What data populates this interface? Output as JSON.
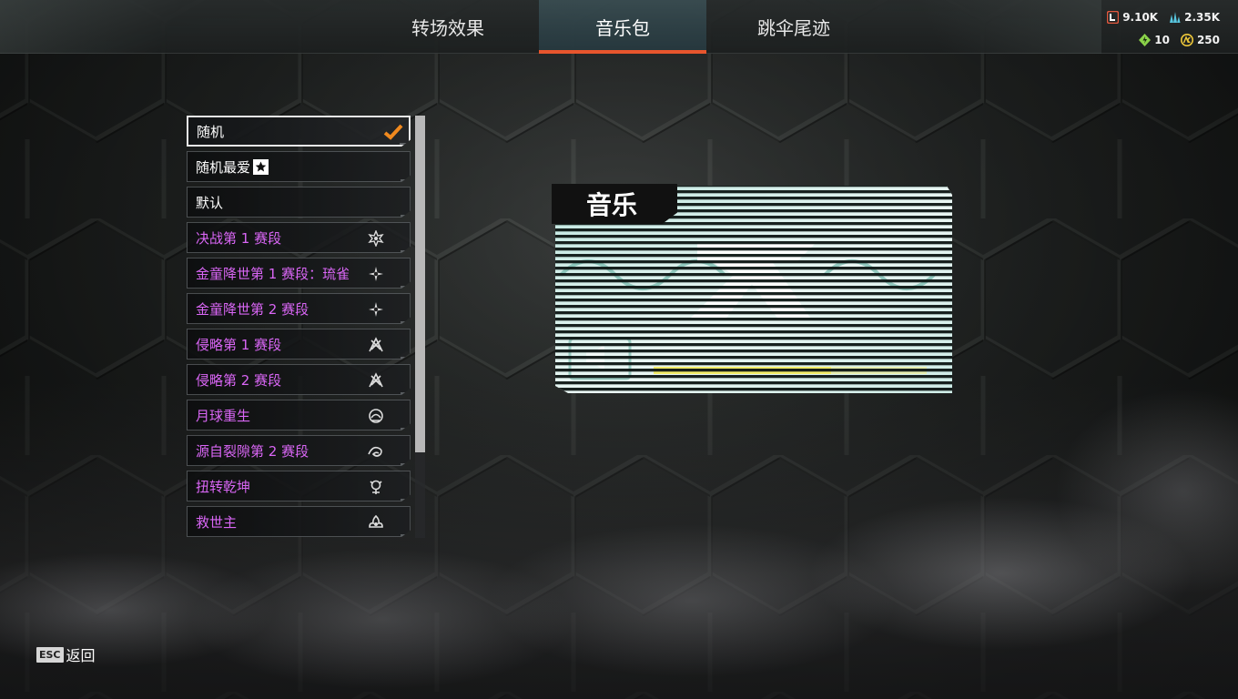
{
  "tabs": [
    {
      "label": "转场效果",
      "active": false
    },
    {
      "label": "音乐包",
      "active": true
    },
    {
      "label": "跳伞尾迹",
      "active": false
    }
  ],
  "currency": {
    "legend_tokens": {
      "value": "9.10K",
      "icon": "legend-token-icon",
      "color": "#e2583e"
    },
    "crafting_metals": {
      "value": "2.35K",
      "icon": "crafting-metals-icon",
      "color": "#58c7e0"
    },
    "exotic_shards": {
      "value": "10",
      "icon": "exotic-shards-icon",
      "color": "#8bd34a"
    },
    "apex_coins": {
      "value": "250",
      "icon": "apex-coins-icon",
      "color": "#f0c93a"
    }
  },
  "music_packs": [
    {
      "label": "随机",
      "selected": true,
      "rarity": "common",
      "icon": "checkmark-icon"
    },
    {
      "label": "随机最爱",
      "selected": false,
      "rarity": "common",
      "icon": "favorite-icon"
    },
    {
      "label": "默认",
      "selected": false,
      "rarity": "common",
      "icon": ""
    },
    {
      "label": "决战第 1 赛段",
      "selected": false,
      "rarity": "epic",
      "icon": "ranked-badge-icon"
    },
    {
      "label": "金童降世第 1 赛段：琉雀",
      "selected": false,
      "rarity": "epic",
      "icon": "event-badge-icon"
    },
    {
      "label": "金童降世第 2 赛段",
      "selected": false,
      "rarity": "epic",
      "icon": "event-badge-icon"
    },
    {
      "label": "侵略第 1 赛段",
      "selected": false,
      "rarity": "epic",
      "icon": "season-badge-icon"
    },
    {
      "label": "侵略第 2 赛段",
      "selected": false,
      "rarity": "epic",
      "icon": "season-badge-icon"
    },
    {
      "label": "月球重生",
      "selected": false,
      "rarity": "epic",
      "icon": "moon-badge-icon"
    },
    {
      "label": "源自裂隙第 2 赛段",
      "selected": false,
      "rarity": "epic",
      "icon": "rift-badge-icon"
    },
    {
      "label": "扭转乾坤",
      "selected": false,
      "rarity": "epic",
      "icon": "flip-badge-icon"
    },
    {
      "label": "救世主",
      "selected": false,
      "rarity": "epic",
      "icon": "savior-badge-icon"
    }
  ],
  "scroll": {
    "visible_fraction": 0.8,
    "position": 0.0
  },
  "preview": {
    "title": "音乐",
    "icon": "audio-speaker-icon",
    "volume_level": 0.65
  },
  "footer": {
    "key_label": "ESC",
    "back_label": "返回"
  },
  "colors": {
    "accent": "#e8552d",
    "epic": "#d966f5",
    "check": "#f0891e"
  }
}
